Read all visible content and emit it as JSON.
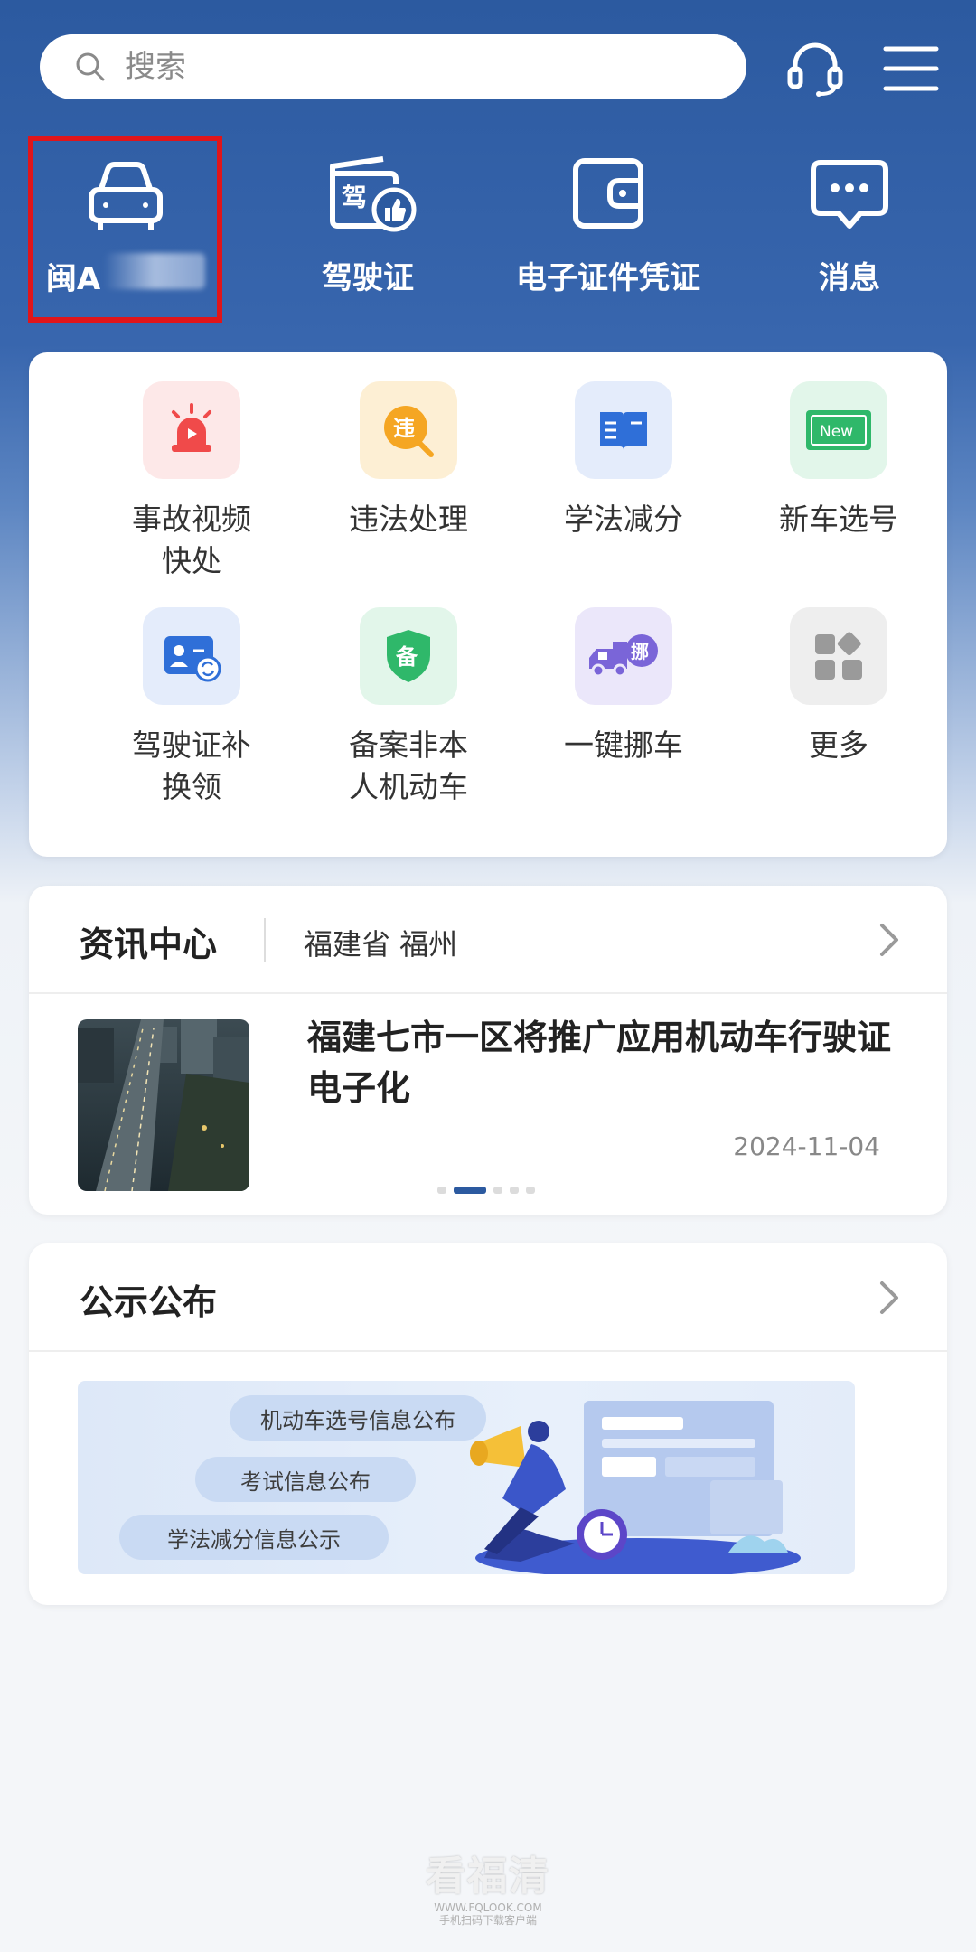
{
  "search": {
    "placeholder": "搜索"
  },
  "header": {
    "headset_icon": "headset-icon",
    "menu_icon": "menu-icon"
  },
  "quick_row": [
    {
      "icon": "car-icon",
      "label": "闽A"
    },
    {
      "icon": "license-icon",
      "label": "驾驶证"
    },
    {
      "icon": "wallet-icon",
      "label": "电子证件凭证"
    },
    {
      "icon": "message-icon",
      "label": "消息"
    }
  ],
  "services": [
    {
      "icon": "alarm-light-icon",
      "label": "事故视频快处",
      "bg": "#fde8e8",
      "color": "#f04a4a"
    },
    {
      "icon": "violation-icon",
      "label": "违法处理",
      "bg": "#fdefd4",
      "color": "#f5a623"
    },
    {
      "icon": "book-icon",
      "label": "学法减分",
      "bg": "#e4ecfb",
      "color": "#2f6fd8"
    },
    {
      "icon": "new-plate-icon",
      "label": "新车选号",
      "bg": "#e2f6ea",
      "color": "#2fb86a"
    },
    {
      "icon": "license-swap-icon",
      "label": "驾驶证补换领",
      "bg": "#e4ecfb",
      "color": "#2f6fd8"
    },
    {
      "icon": "shield-icon",
      "label": "备案非本人机动车",
      "bg": "#e2f6ea",
      "color": "#2fb86a"
    },
    {
      "icon": "tow-truck-icon",
      "label": "一键挪车",
      "bg": "#ebe7fa",
      "color": "#7a65d8"
    },
    {
      "icon": "grid-icon",
      "label": "更多",
      "bg": "#eeeeee",
      "color": "#9a9a9a"
    }
  ],
  "news": {
    "title": "资讯中心",
    "region": "福建省 福州",
    "headline": "福建七市一区将推广应用机动车行驶证电子化",
    "date": "2024-11-04",
    "carousel_count": 5,
    "carousel_active": 2
  },
  "notices": {
    "title": "公示公布",
    "pills": [
      "机动车选号信息公布",
      "考试信息公布",
      "学法减分信息公示"
    ]
  },
  "watermark": {
    "title": "看福清",
    "sub1": "WWW.FQLOOK.COM",
    "sub2": "手机扫码下载客户端"
  },
  "colors": {
    "brand": "#2c5aa0",
    "highlight": "#e0151a"
  }
}
